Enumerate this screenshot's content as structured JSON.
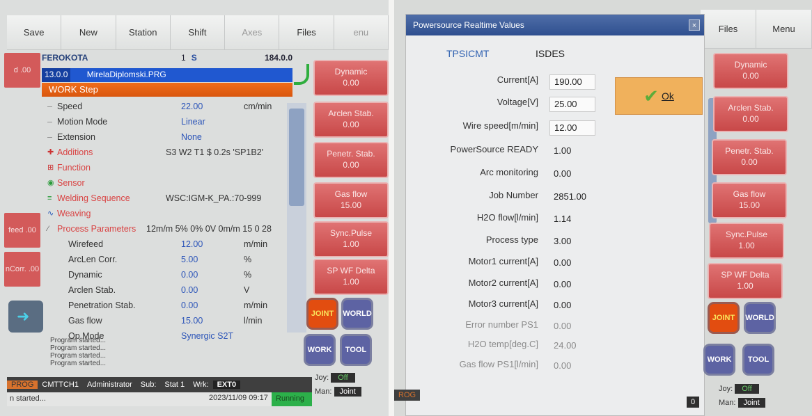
{
  "left": {
    "toolbar": [
      "Save",
      "New",
      "Station",
      "Shift",
      "Axes",
      "Files",
      "enu"
    ],
    "program": {
      "robot": "FEROKOTA",
      "line": "1",
      "mode_letter": "S",
      "value": "184.0.0",
      "version": "13.0.0",
      "file": "MirelaDiplomski.PRG",
      "step": "WORK Step"
    },
    "params": [
      {
        "label": "Speed",
        "value": "22.00",
        "unit": "cm/min"
      },
      {
        "label": "Motion Mode",
        "value": "Linear",
        "unit": ""
      },
      {
        "label": "Extension",
        "value": "None",
        "unit": ""
      }
    ],
    "groups": [
      {
        "label": "Additions",
        "text": "S3 W2 T1 $ 0.2s 'SP1B2'"
      },
      {
        "label": "Function",
        "text": ""
      },
      {
        "label": "Sensor",
        "text": ""
      },
      {
        "label": "Welding Sequence",
        "text": "WSC:IGM-K_PA.:70-999"
      },
      {
        "label": "Weaving",
        "text": ""
      },
      {
        "label": "Process Parameters",
        "text": "12m/m 5% 0% 0V 0m/m 15 0 28"
      }
    ],
    "process": [
      {
        "label": "Wirefeed",
        "value": "12.00",
        "unit": "m/min"
      },
      {
        "label": "ArcLen Corr.",
        "value": "5.00",
        "unit": "%"
      },
      {
        "label": "Dynamic",
        "value": "0.00",
        "unit": "%"
      },
      {
        "label": "Arclen Stab.",
        "value": "0.00",
        "unit": "V"
      },
      {
        "label": "Penetration Stab.",
        "value": "0.00",
        "unit": "m/min"
      },
      {
        "label": "Gas flow",
        "value": "15.00",
        "unit": "l/min"
      },
      {
        "label": "Op.Mode",
        "value": "Synergic S2T",
        "unit": ""
      }
    ],
    "logs": [
      "Program started...",
      "Program started...",
      "Program started...",
      "Program started..."
    ],
    "side_buttons": [
      {
        "label": "Dynamic",
        "value": "0.00"
      },
      {
        "label": "Arclen Stab.",
        "value": "0.00"
      },
      {
        "label": "Penetr. Stab.",
        "value": "0.00"
      },
      {
        "label": "Gas flow",
        "value": "15.00"
      },
      {
        "label": "Sync.Pulse",
        "value": "1.00"
      },
      {
        "label": "SP WF Delta",
        "value": "1.00"
      }
    ],
    "stubs": [
      "d",
      ".00",
      "feed",
      ".00",
      "nCorr.",
      ".00"
    ],
    "modes": [
      "JOINT",
      "WORLD",
      "WORK",
      "TOOL"
    ],
    "status": {
      "prog": "PROG",
      "cmt": "CMTTCH1",
      "user": "Administrator",
      "sub_label": "Sub:",
      "stat": "Stat 1",
      "wrk_label": "Wrk:",
      "ext": "EXT0",
      "started": "n started...",
      "date": "2023/11/09 09:17",
      "running": "Running",
      "joy_label": "Joy:",
      "joy_val": "Off",
      "man_label": "Man:",
      "man_val": "Joint"
    }
  },
  "right": {
    "dialog_title": "Powersource Realtime Values",
    "close": "×",
    "source": "TPSICMT",
    "source_id": "ISDES",
    "ok": "Ok",
    "rows": [
      {
        "key": "Current[A]",
        "value": "190.00",
        "boxed": true
      },
      {
        "key": "Voltage[V]",
        "value": "25.00",
        "boxed": true
      },
      {
        "key": "Wire speed[m/min]",
        "value": "12.00",
        "boxed": true
      },
      {
        "key": "PowerSource READY",
        "value": "1.00",
        "boxed": false
      },
      {
        "key": "Arc monitoring",
        "value": "0.00",
        "boxed": false
      },
      {
        "key": "Job Number",
        "value": "2851.00",
        "boxed": false
      },
      {
        "key": "H2O flow[l/min]",
        "value": "1.14",
        "boxed": false
      },
      {
        "key": "Process type",
        "value": "3.00",
        "boxed": false
      },
      {
        "key": "Motor1 current[A]",
        "value": "0.00",
        "boxed": false
      },
      {
        "key": "Motor2 current[A]",
        "value": "0.00",
        "boxed": false
      },
      {
        "key": "Motor3 current[A]",
        "value": "0.00",
        "boxed": false
      },
      {
        "key": "Error number PS1",
        "value": "0.00",
        "boxed": false
      },
      {
        "key": "H2O temp[deg.C]",
        "value": "24.00",
        "boxed": false
      },
      {
        "key": "Gas flow PS1[l/min]",
        "value": "0.00",
        "boxed": false
      }
    ],
    "toolbar": [
      "Files",
      "Menu"
    ],
    "side_buttons": [
      {
        "label": "Dynamic",
        "value": "0.00"
      },
      {
        "label": "Arclen Stab.",
        "value": "0.00"
      },
      {
        "label": "Penetr. Stab.",
        "value": "0.00"
      },
      {
        "label": "Gas flow",
        "value": "15.00"
      },
      {
        "label": "Sync.Pulse",
        "value": "1.00"
      },
      {
        "label": "SP WF Delta",
        "value": "1.00"
      }
    ],
    "modes": [
      "JOINT",
      "WORLD",
      "WORK",
      "TOOL"
    ],
    "joy_label": "Joy:",
    "joy_val": "Off",
    "man_label": "Man:",
    "man_val": "Joint",
    "bottom_left": "ROG",
    "bottom_mid": "0"
  }
}
